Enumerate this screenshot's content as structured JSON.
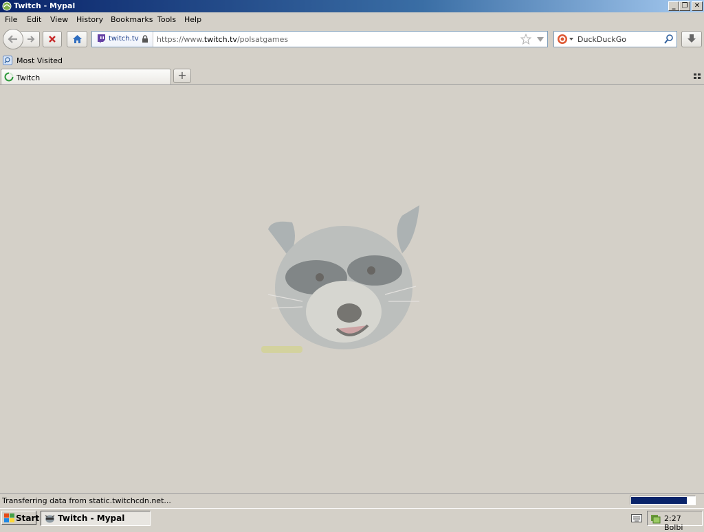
{
  "window": {
    "title": "Twitch - Mypal",
    "minimize_glyph": "_",
    "restore_glyph": "❐",
    "close_glyph": "✕"
  },
  "menu": {
    "file": "File",
    "edit": "Edit",
    "view": "View",
    "history": "History",
    "bookmarks": "Bookmarks",
    "tools": "Tools",
    "help": "Help"
  },
  "navbar": {
    "identity_site": "twitch.tv",
    "url_prefix": "https://www.",
    "url_host": "twitch.tv",
    "url_path": "/polsatgames",
    "search_placeholder": "DuckDuckGo"
  },
  "bookmarks": {
    "most_visited": "Most Visited"
  },
  "tabs": {
    "active_label": "Twitch",
    "new_tab_glyph": "+"
  },
  "status": {
    "text": "Transferring data from static.twitchcdn.net...",
    "progress_fraction": 0.88
  },
  "taskbar": {
    "start_label": "Start",
    "task_label": "Twitch - Mypal",
    "clock": "2:27 Bolbi"
  },
  "colors": {
    "titlebar_start": "#0a246a",
    "window_bg": "#d4d0c8",
    "progress": "#0a246a",
    "twitch_purple": "#6441a5",
    "home_blue": "#2f6dbf",
    "stop_red": "#c62828"
  }
}
